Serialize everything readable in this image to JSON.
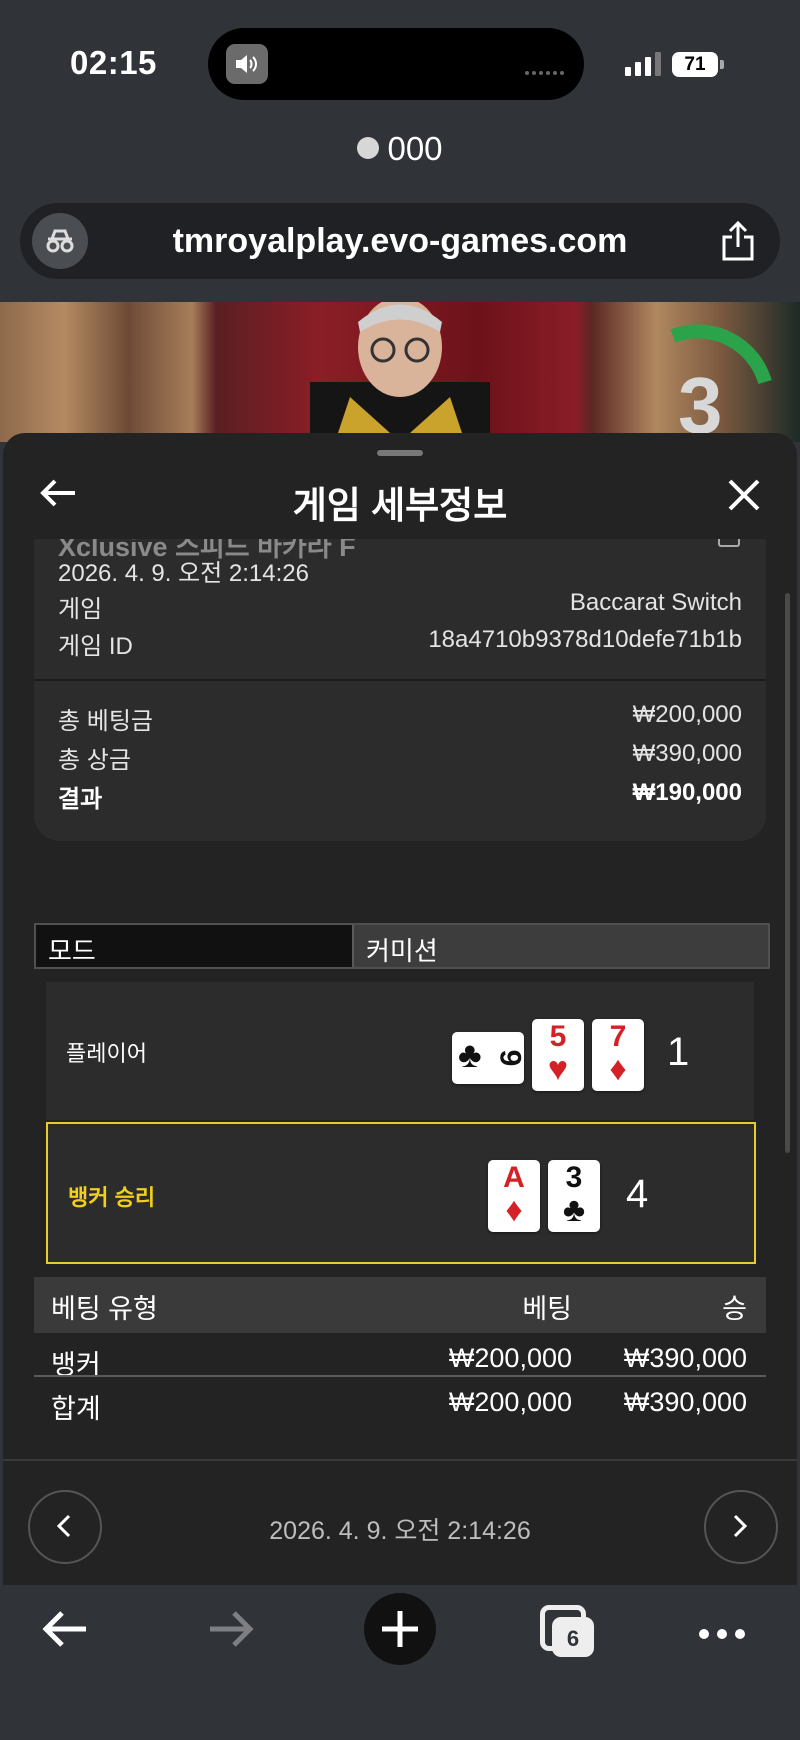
{
  "status_bar": {
    "time": "02:15",
    "battery": "71"
  },
  "recording": {
    "label": "000"
  },
  "browser": {
    "url": "tmroyalplay.evo-games.com"
  },
  "video": {
    "badge": "3"
  },
  "panel": {
    "title": "게임 세부정보",
    "partial_title": "Xclusive 스피드 바카라 F",
    "datetime": "2026. 4. 9. 오전 2:14:26",
    "game_label": "게임",
    "game_value": "Baccarat Switch",
    "game_id_label": "게임 ID",
    "game_id_value": "18a4710b9378d10defe71b1b",
    "total_bet_label": "총 베팅금",
    "total_bet_value": "₩200,000",
    "total_win_label": "총 상금",
    "total_win_value": "₩390,000",
    "result_label": "결과",
    "result_value": "₩190,000",
    "mode_label": "모드",
    "mode_value": "커미션",
    "player": {
      "label": "플레이어",
      "score": "1",
      "cards": [
        {
          "rank": "9",
          "suit": "♣",
          "color": "black",
          "sideways": true
        },
        {
          "rank": "5",
          "suit": "♥",
          "color": "red"
        },
        {
          "rank": "7",
          "suit": "♦",
          "color": "red"
        }
      ]
    },
    "banker": {
      "label": "뱅커 승리",
      "score": "4",
      "cards": [
        {
          "rank": "A",
          "suit": "♦",
          "color": "red"
        },
        {
          "rank": "3",
          "suit": "♣",
          "color": "black"
        }
      ]
    },
    "table": {
      "headers": [
        "베팅 유형",
        "베팅",
        "승"
      ],
      "rows": [
        [
          "뱅커",
          "₩200,000",
          "₩390,000"
        ]
      ],
      "total": [
        "합계",
        "₩200,000",
        "₩390,000"
      ]
    },
    "nav_date": "2026. 4. 9. 오전 2:14:26"
  },
  "toolbar": {
    "tab_count": "6"
  },
  "colors": {
    "win_accent": "#f0cf1d",
    "red_suit": "#d42127",
    "panel_bg": "#232323"
  }
}
